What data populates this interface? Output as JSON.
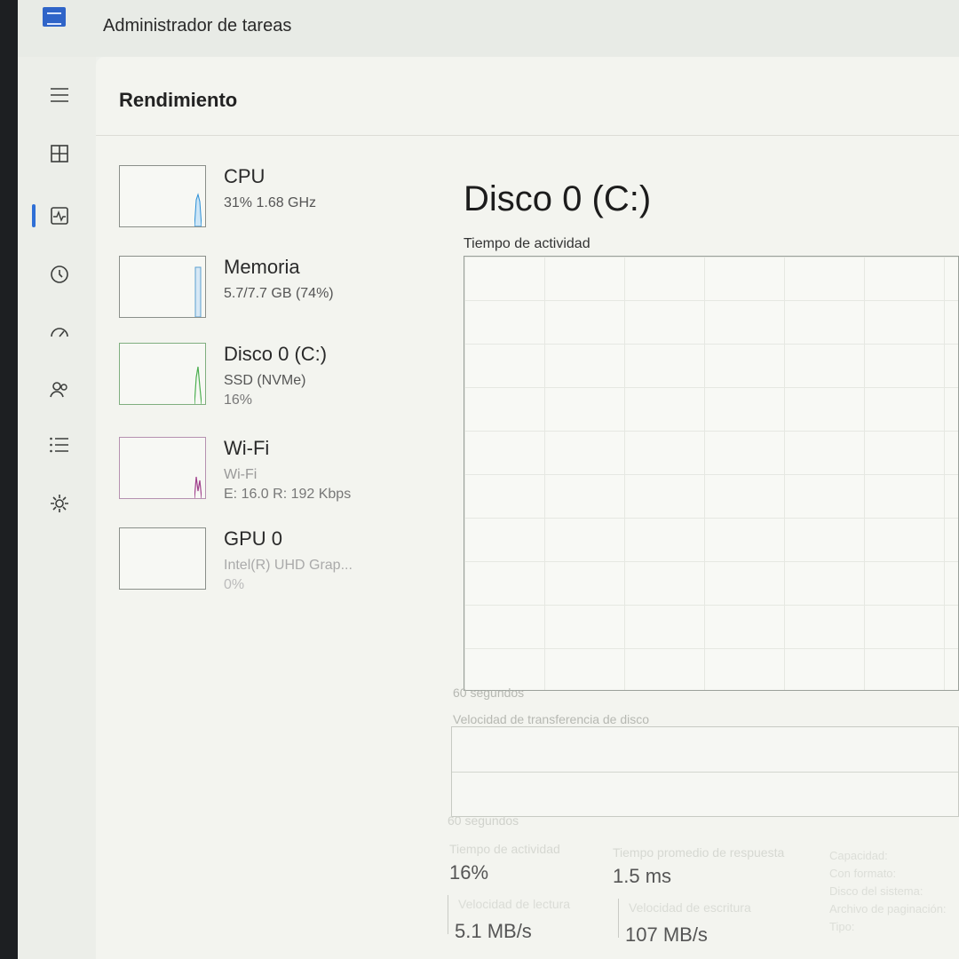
{
  "window": {
    "title": "Administrador de tareas"
  },
  "header": {
    "title": "Rendimiento"
  },
  "resources": [
    {
      "name": "CPU",
      "sub": "31%  1.68 GHz",
      "sub2": ""
    },
    {
      "name": "Memoria",
      "sub": "5.7/7.7 GB (74%)",
      "sub2": ""
    },
    {
      "name": "Disco 0 (C:)",
      "sub": "SSD (NVMe)",
      "sub2": "16%"
    },
    {
      "name": "Wi-Fi",
      "sub": "Wi-Fi",
      "sub2": "E: 16.0  R: 192 Kbps"
    },
    {
      "name": "GPU 0",
      "sub": "Intel(R) UHD Grap...",
      "sub2": "0%"
    }
  ],
  "detail": {
    "title": "Disco 0 (C:)",
    "graph_label": "Tiempo de actividad",
    "time_span": "60 segundos",
    "graph2_label": "Velocidad de transferencia de disco",
    "time_span2": "60 segundos"
  },
  "stats": [
    {
      "label": "Tiempo de actividad",
      "value": "16%"
    },
    {
      "label": "Tiempo promedio de respuesta",
      "value": "1.5 ms"
    },
    {
      "label": "Velocidad de lectura",
      "value": "5.1 MB/s"
    },
    {
      "label": "Velocidad de escritura",
      "value": "107 MB/s"
    }
  ],
  "side_info": [
    "Capacidad:",
    "Con formato:",
    "Disco del sistema:",
    "Archivo de paginación:",
    "Tipo:"
  ],
  "nav_icons": [
    "menu-icon",
    "processes-icon",
    "performance-icon",
    "app-history-icon",
    "startup-icon",
    "users-icon",
    "details-icon",
    "services-icon"
  ],
  "colors": {
    "accent": "#2f6fd6",
    "cpu": "#2b8fd6",
    "memory": "#5b9fd0",
    "disk": "#4caf50",
    "wifi": "#a0408c"
  }
}
